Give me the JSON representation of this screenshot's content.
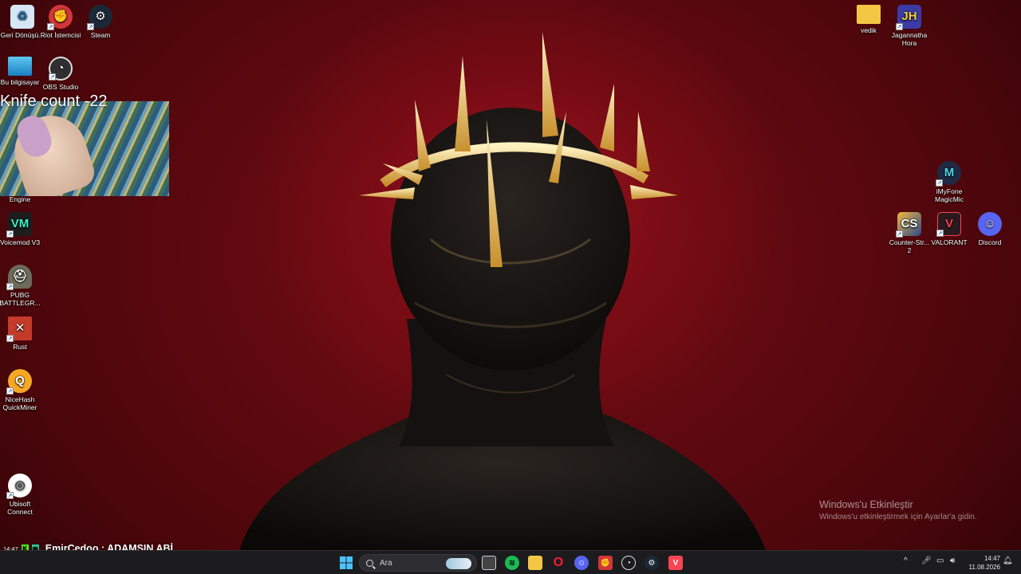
{
  "desktop": {
    "left_icons": [
      {
        "label": "Geri Dönüşü...",
        "icon": "recycle-bin-icon",
        "color": "#7fb2d8"
      },
      {
        "label": "Riot İstemcisi",
        "icon": "riot-client-icon",
        "color": "#d13639"
      },
      {
        "label": "Steam",
        "icon": "steam-icon",
        "color": "#1b2838"
      },
      {
        "label": "Bu bilgisayar",
        "icon": "this-pc-icon",
        "color": "#3aa4e0"
      },
      {
        "label": "OBS Studio",
        "icon": "obs-icon",
        "color": "#302e31"
      },
      {
        "label": "Engine",
        "icon": "engine-icon",
        "color": ""
      },
      {
        "label": "Voicemod V3",
        "icon": "voicemod-icon",
        "color": "#1d1d1d"
      },
      {
        "label": "PUBG BATTLEGR...",
        "icon": "pubg-icon",
        "color": "#7a7a6a"
      },
      {
        "label": "Rust",
        "icon": "rust-icon",
        "color": "#c43b2a"
      },
      {
        "label": "NiceHash QuickMiner",
        "icon": "nicehash-icon",
        "color": "#f7a823"
      },
      {
        "label": "Ubisoft Connect",
        "icon": "ubisoft-icon",
        "color": "#ffffff"
      }
    ],
    "right_icons": [
      {
        "label": "vedik",
        "icon": "folder-icon",
        "color": "#f3c744"
      },
      {
        "label": "Jagannatha Hora",
        "icon": "jagannatha-hora-icon",
        "color": "#3b3ba8"
      },
      {
        "label": "iMyFone MagicMic",
        "icon": "magicmic-icon",
        "color": "#1e2a44"
      },
      {
        "label": "Counter-Str... 2",
        "icon": "counter-strike-icon",
        "color": "#e0a030"
      },
      {
        "label": "VALORANT",
        "icon": "valorant-icon",
        "color": "#fa4454"
      },
      {
        "label": "Discord",
        "icon": "discord-icon",
        "color": "#5865f2"
      }
    ]
  },
  "overlay": {
    "webcam_title": "Knife count -22"
  },
  "chat": {
    "time": "14:47",
    "message": "EmirCedoo : ADAMSIN ABİ"
  },
  "watermark": {
    "title": "Windows'u Etkinleştir",
    "subtitle": "Windows'u etkinleştirmek için Ayarlar'a gidin."
  },
  "taskbar": {
    "search_placeholder": "Ara",
    "apps": [
      "start-icon",
      "task-view-icon",
      "spotify-icon",
      "file-explorer-icon",
      "opera-icon",
      "discord-icon",
      "riot-client-icon",
      "obs-icon",
      "steam-icon",
      "valorant-icon"
    ],
    "clock_time": "14:47",
    "clock_date": "11.08.2026"
  }
}
